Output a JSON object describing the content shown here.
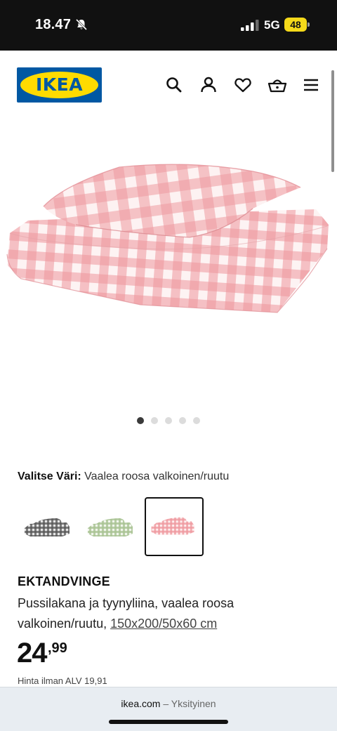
{
  "status_bar": {
    "time": "18.47",
    "network": "5G",
    "battery": "48"
  },
  "header": {
    "logo_text": "IKEA",
    "icons": [
      "search-icon",
      "account-icon",
      "heart-icon",
      "shopping-bag-icon",
      "menu-icon"
    ]
  },
  "gallery": {
    "image_count": 5,
    "active_index": 0
  },
  "color_selector": {
    "label": "Valitse Väri:",
    "value": "Vaalea roosa valkoinen/ruutu",
    "swatches": [
      {
        "color": "#4a4a4a",
        "selected": false
      },
      {
        "color": "#b9cfa6",
        "selected": false
      },
      {
        "color": "#ef9a9a",
        "selected": true
      }
    ]
  },
  "product": {
    "name": "EKTANDVINGE",
    "description": "Pussilakana ja tyynyliina, vaalea roosa valkoinen/ruutu,",
    "size_link": "150x200/50x60 cm",
    "price_int": "24",
    "price_dec": ",99",
    "vat_note": "Hinta ilman ALV 19,91"
  },
  "browser": {
    "domain": "ikea.com",
    "subtitle": "– Yksityinen"
  },
  "colors": {
    "brand_blue": "#0058a3",
    "brand_yellow": "#ffdb00",
    "check_pink": "#ef9aa0"
  }
}
